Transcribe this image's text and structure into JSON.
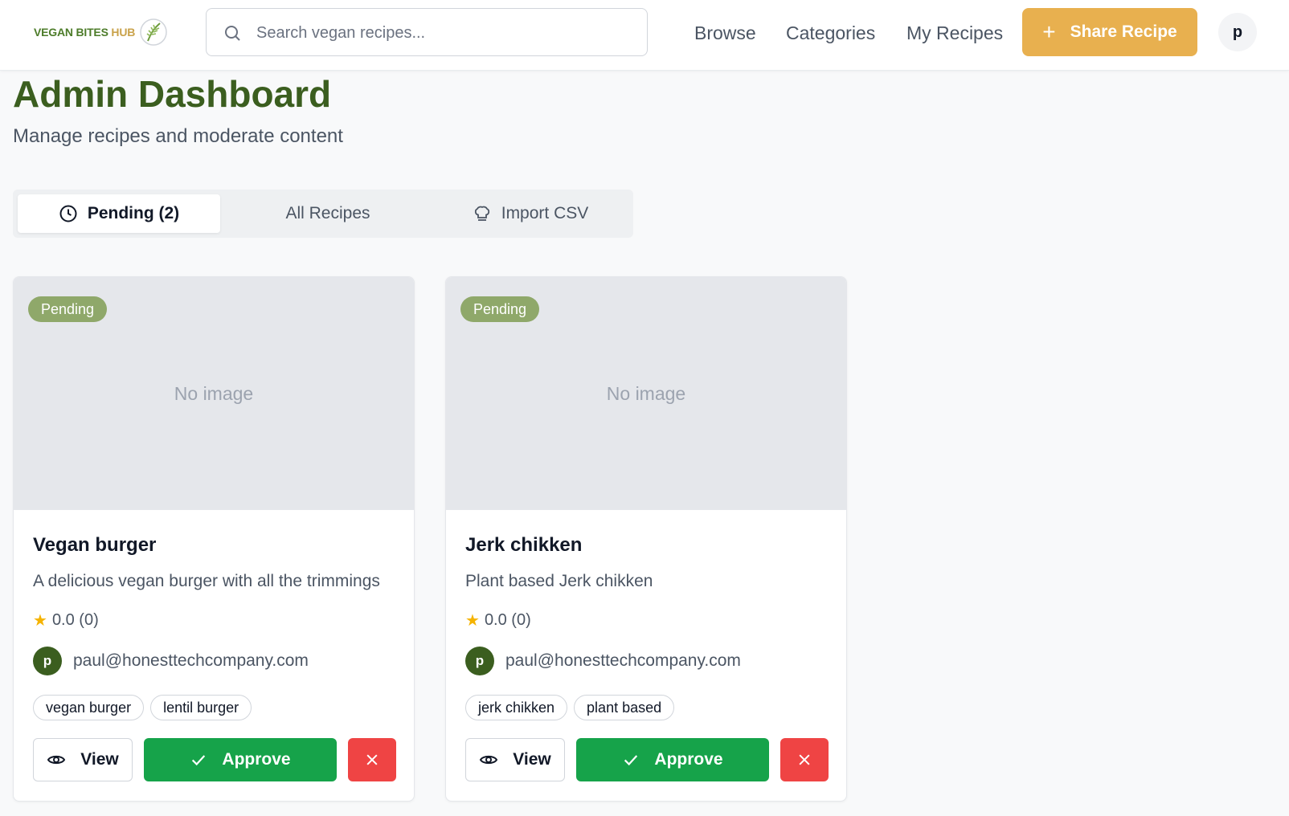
{
  "header": {
    "logo_text": "VEGAN BITES",
    "logo_hub": "HUB",
    "search_placeholder": "Search vegan recipes...",
    "nav": [
      "Browse",
      "Categories",
      "My Recipes"
    ],
    "share_label": "Share Recipe",
    "user_initial": "p"
  },
  "page": {
    "title": "Admin Dashboard",
    "subtitle": "Manage recipes and moderate content"
  },
  "tabs": [
    {
      "label": "Pending (2)",
      "icon": "clock-icon",
      "active": true
    },
    {
      "label": "All Recipes",
      "icon": "",
      "active": false
    },
    {
      "label": "Import CSV",
      "icon": "chef-hat-icon",
      "active": false
    }
  ],
  "recipes": [
    {
      "status": "Pending",
      "image_text": "No image",
      "title": "Vegan burger",
      "description": "A delicious vegan burger with all the trimmings",
      "rating": "0.0 (0)",
      "author_initial": "p",
      "author_email": "paul@honesttechcompany.com",
      "tags": [
        "vegan burger",
        "lentil burger"
      ],
      "view_label": "View",
      "approve_label": "Approve"
    },
    {
      "status": "Pending",
      "image_text": "No image",
      "title": "Jerk chikken",
      "description": "Plant based Jerk chikken",
      "rating": "0.0 (0)",
      "author_initial": "p",
      "author_email": "paul@honesttechcompany.com",
      "tags": [
        "jerk chikken",
        "plant based"
      ],
      "view_label": "View",
      "approve_label": "Approve"
    }
  ],
  "colors": {
    "brand_green": "#3b5e1f",
    "accent_orange": "#e8b04f",
    "approve_green": "#16a34a",
    "reject_red": "#ef4444",
    "badge_green": "#8fa86a"
  }
}
